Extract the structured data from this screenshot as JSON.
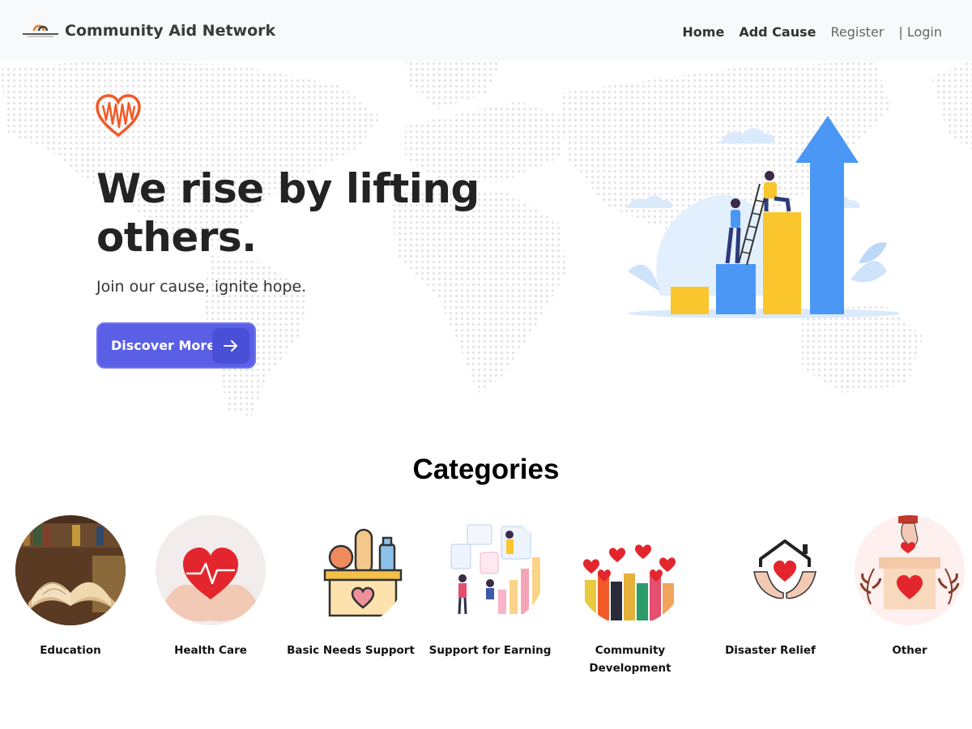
{
  "brand": {
    "name": "Community Aid Network"
  },
  "nav": {
    "home": "Home",
    "add_cause": "Add Cause",
    "register": "Register",
    "login": "| Login"
  },
  "hero": {
    "title": "We rise by lifting others.",
    "subtitle": "Join our cause, ignite hope.",
    "cta_label": "Discover More",
    "cta_icon": "arrow-right-icon"
  },
  "categories": {
    "title": "Categories",
    "items": [
      {
        "label": "Education",
        "icon": "open-book-icon"
      },
      {
        "label": "Health Care",
        "icon": "heart-in-hands-icon"
      },
      {
        "label": "Basic Needs Support",
        "icon": "grocery-box-icon"
      },
      {
        "label": "Support for Earning",
        "icon": "growth-people-icon"
      },
      {
        "label": "Community Development",
        "icon": "raised-hands-icon"
      },
      {
        "label": "Disaster Relief",
        "icon": "house-hands-icon"
      },
      {
        "label": "Other",
        "icon": "donation-box-icon"
      }
    ]
  },
  "colors": {
    "accent": "#5a5fe6",
    "heart": "#f05a28",
    "bar_blue": "#4a97f5",
    "bar_yellow": "#fbc52d"
  }
}
